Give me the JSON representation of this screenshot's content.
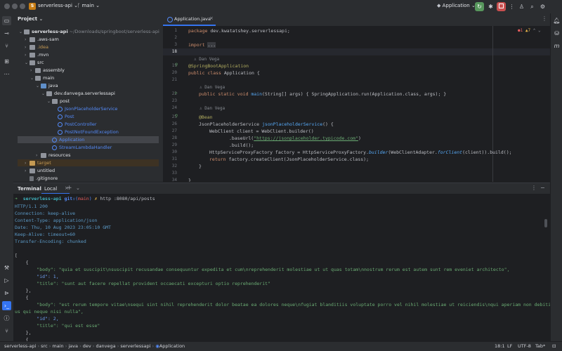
{
  "titlebar": {
    "project_badge": "S",
    "project_name": "serverless-api",
    "branch": "main",
    "run_config": "Application"
  },
  "project_panel": {
    "title": "Project",
    "items": [
      {
        "label": "serverless-api",
        "suffix": "~/Downloads/springboot/serverless-api"
      },
      {
        "label": ".aws-sam"
      },
      {
        "label": ".idea"
      },
      {
        "label": ".mvn"
      },
      {
        "label": "src"
      },
      {
        "label": "assembly"
      },
      {
        "label": "main"
      },
      {
        "label": "java"
      },
      {
        "label": "dev.danvega.serverlessapi"
      },
      {
        "label": "post"
      },
      {
        "label": "JsonPlaceholderService"
      },
      {
        "label": "Post"
      },
      {
        "label": "PostController"
      },
      {
        "label": "PostNotFoundException"
      },
      {
        "label": "Application"
      },
      {
        "label": "StreamLambdaHandler"
      },
      {
        "label": "resources"
      },
      {
        "label": "target"
      },
      {
        "label": "untitled"
      },
      {
        "label": ".gitignore"
      }
    ]
  },
  "editor": {
    "tab": "Application.java",
    "inspections": {
      "errors": "1",
      "warnings": "7"
    },
    "line_numbers": [
      "1",
      "2",
      "3",
      "18",
      "19",
      "20",
      "21",
      "22",
      "23",
      "24",
      "25",
      "26",
      "27",
      "28",
      "29",
      "30",
      "31",
      "32",
      "33",
      "34",
      "35"
    ],
    "author_hint": "Dan Vega",
    "code": {
      "l1_kw": "package ",
      "l1_rest": "dev.kwatatshey.serverlessapi;",
      "l3_kw": "import ",
      "l3_rest": "...",
      "l19": "@SpringBootApplication",
      "l20_kw": "public class ",
      "l20_rest": "Application {",
      "l22_kw": "public static void ",
      "l22_fn": "main",
      "l22_rest": "(String[] args) { SpringApplication.run(Application.class, args); }",
      "l25": "@Bean",
      "l26_a": "JsonPlaceholderService ",
      "l26_fn": "jsonPlaceholderService",
      "l26_b": "() {",
      "l27": "WebClient client = WebClient.builder()",
      "l28_a": ".baseUrl(",
      "l28_str": "\"https://jsonplaceholder.typicode.com\"",
      "l28_b": ")",
      "l29": ".build();",
      "l30_a": "HttpServiceProxyFactory factory = HttpServiceProxyFactory.",
      "l30_it": "builder",
      "l30_b": "(WebClientAdapter.",
      "l30_it2": "forClient",
      "l30_c": "(client)).build();",
      "l31_kw": "return ",
      "l31_rest": "factory.createClient(JsonPlaceholderService.class);",
      "l32": "}",
      "l34": "}"
    }
  },
  "terminal": {
    "tab_terminal": "Terminal",
    "tab_local": "Local",
    "prompt_arrow": "➜",
    "prompt_dir": "serverless-api",
    "prompt_git": "git:",
    "prompt_branch_open": "(",
    "prompt_branch": "main",
    "prompt_branch_close": ")",
    "prompt_x": "✗",
    "command": "http :8080/api/posts",
    "lines": [
      "HTTP/1.1 200",
      "Connection: keep-alive",
      "Content-Type: application/json",
      "Date: Thu, 10 Aug 2023 23:05:10 GMT",
      "Keep-Alive: timeout=60",
      "Transfer-Encoding: chunked",
      "",
      "[",
      "    {",
      "        \"body\": \"quia et suscipit\\nsuscipit recusandae consequuntur expedita et cum\\nreprehenderit molestiae ut ut quas totam\\nnostrum rerum est autem sunt rem eveniet architecto\",",
      "        \"id\": 1,",
      "        \"title\": \"sunt aut facere repellat provident occaecati excepturi optio reprehenderit\"",
      "    },",
      "    {",
      "        \"body\": \"est rerum tempore vitae\\nsequi sint nihil reprehenderit dolor beatae ea dolores neque\\nfugiat blanditiis voluptate porro vel nihil molestiae ut reiciendis\\nqui aperiam non debitis possim",
      "us qui neque nisi nulla\",",
      "        \"id\": 2,",
      "        \"title\": \"qui est esse\"",
      "    },",
      "    {"
    ]
  },
  "statusbar": {
    "breadcrumbs": [
      "serverless-api",
      "src",
      "main",
      "java",
      "dev",
      "danvega",
      "serverlessapi",
      "Application"
    ],
    "position": "18:1",
    "line_sep": "LF",
    "encoding": "UTF-8",
    "indent": "Tab*"
  }
}
